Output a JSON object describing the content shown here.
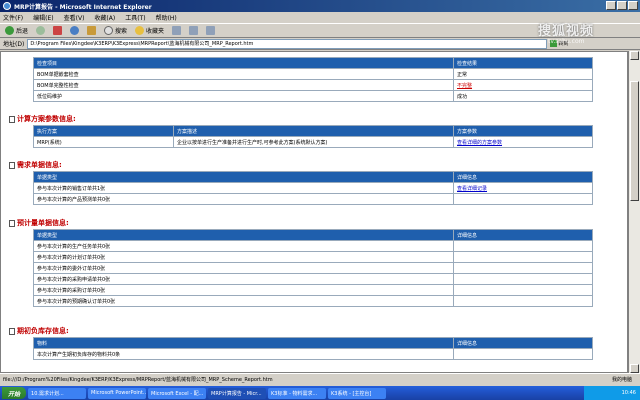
{
  "window": {
    "title": "MRP计算报告 - Microsoft Internet Explorer"
  },
  "menu": [
    "文件(F)",
    "编辑(E)",
    "查看(V)",
    "收藏(A)",
    "工具(T)",
    "帮助(H)"
  ],
  "toolbar": {
    "back": "后退",
    "search": "搜索",
    "favorites": "收藏夹"
  },
  "address": {
    "label": "地址(D)",
    "value": "D:\\Program Files\\Kingdee\\K3ERP\\K3Express\\MRPReport\\蓝海机械有限公司_MRP_Report.htm",
    "go": "转到"
  },
  "check_table": {
    "headers": [
      "检查项目",
      "检查结果"
    ],
    "rows": [
      [
        "BOM单据嵌套检查",
        "正常"
      ],
      [
        "BOM单完整性检查",
        "不完整"
      ],
      [
        "低位码维护",
        "成功"
      ]
    ]
  },
  "sections": {
    "plan": "计算方案参数信息:",
    "demand": "需求单据信息:",
    "forecast": "预计量单据信息:",
    "initial": "期初负库存信息:"
  },
  "plan_table": {
    "headers": [
      "执行方案",
      "方案描述",
      "方案参数"
    ],
    "row": [
      "MRP(系统)",
      "企业以按单进行生产准备并进行生产时,可参考此方案(系统默认方案)",
      "查看详细的方案参数"
    ]
  },
  "demand_table": {
    "headers": [
      "单据类型",
      "详细信息"
    ],
    "rows": [
      [
        "参与本次计算的销售订单共1张",
        "查看详细记录"
      ],
      [
        "参与本次计算的产品预测单共0张",
        ""
      ]
    ]
  },
  "forecast_table": {
    "headers": [
      "单据类型",
      "详细信息"
    ],
    "rows": [
      [
        "参与本次计算的生产任务单共0张",
        ""
      ],
      [
        "参与本次计算的计划订单共0张",
        ""
      ],
      [
        "参与本次计算的委外订单共0张",
        ""
      ],
      [
        "参与本次计算的采购申请单共0张",
        ""
      ],
      [
        "参与本次计算的采购订单共0张",
        ""
      ],
      [
        "参与本次计算的预期确认订单共0张",
        ""
      ]
    ]
  },
  "initial_table": {
    "headers": [
      "物料",
      "详细信息"
    ],
    "rows": [
      [
        "本次计算产生期初负库存的物料共0条",
        ""
      ]
    ]
  },
  "status": {
    "text": "file:///D:/Program%20Files/Kingdee/K3ERP/K3Express/MRPReport/蓝海机械有限公司_MRP_Scheme_Report.htm",
    "zone": "我的电脑"
  },
  "taskbar": {
    "start": "开始",
    "tasks": [
      "10.需求计划...",
      "Microsoft PowerPoint...",
      "Microsoft Excel - 配...",
      "MRP计算报告 - Micr...",
      "K3标准 - 物料需求...",
      "K3系统 - [主控台]"
    ],
    "clock": "10:46"
  },
  "watermark": {
    "main": "搜狐视频",
    "sub": "tv.sohu.com"
  }
}
